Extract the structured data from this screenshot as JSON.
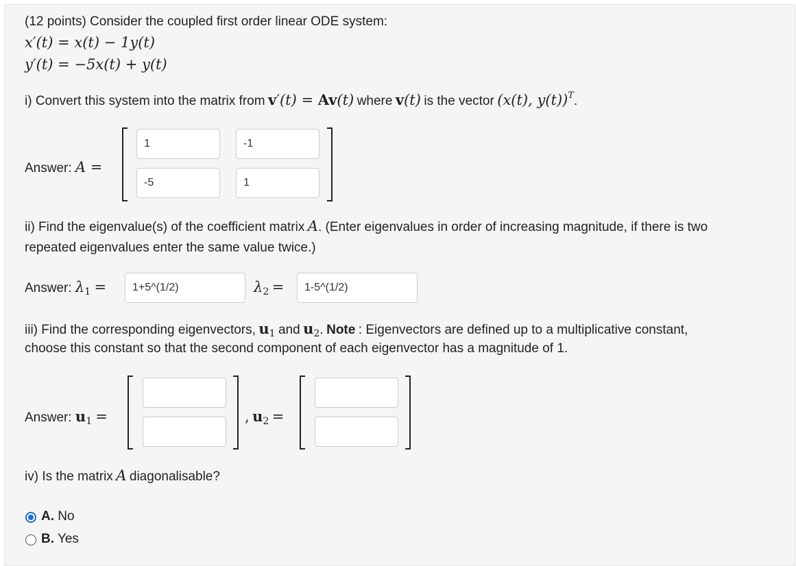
{
  "intro": "(12 points) Consider the coupled first order linear ODE system:",
  "eq1": "x′(t) = x(t) − 1y(t)",
  "eq2": "y′(t) = −5x(t) + y(t)",
  "part_i": {
    "text_a": "i) Convert this system into the matrix from",
    "math_a": "v′(t) = Av(t)",
    "text_b": "where",
    "math_b": "v(t)",
    "text_c": "is the vector",
    "math_c": "(x(t), y(t))",
    "math_c_sup": "T",
    "text_d": ".",
    "answer_label": "Answer:",
    "answer_math": "A =",
    "matrix": {
      "a11": "1",
      "a12": "-1",
      "a21": "-5",
      "a22": "1"
    }
  },
  "part_ii": {
    "text_a": "ii) Find the eigenvalue(s) of the coefficient matrix",
    "math_a": "A",
    "text_b": ". (Enter eigenvalues in order of increasing magnitude, if there is two",
    "line2": "repeated eigenvalues enter the same value twice.)",
    "answer_label": "Answer:",
    "lambda1_sym": "λ",
    "lambda1_sub": "1",
    "lambda2_sym": "λ",
    "lambda2_sub": "2",
    "equals": "=",
    "lambda1_value": "1+5^(1/2)",
    "lambda2_value": "1-5^(1/2)"
  },
  "part_iii": {
    "text_a": "iii) Find the corresponding eigenvectors,",
    "u1_sym": "u",
    "u1_sub": "1",
    "text_and": "and",
    "u2_sym": "u",
    "u2_sub": "2",
    "text_dot": ".",
    "note_bold": "Note",
    "text_b": ": Eigenvectors are defined up to a multiplicative constant,",
    "line2": "choose this constant so that the second component of each eigenvector has a magnitude of 1.",
    "answer_label": "Answer:",
    "equals": "=",
    "comma": ",",
    "u1_top": "",
    "u1_bottom": "",
    "u2_top": "",
    "u2_bottom": ""
  },
  "part_iv": {
    "text_a": "iv) Is the matrix",
    "math_a": "A",
    "text_b": "diagonalisable?",
    "options": [
      {
        "letter": "A.",
        "label": "No",
        "selected": true
      },
      {
        "letter": "B.",
        "label": "Yes",
        "selected": false
      }
    ]
  },
  "colors": {
    "panel_bg": "#f5f5f5",
    "radio_selected": "#1e6fd0",
    "input_border": "#cccccc"
  }
}
